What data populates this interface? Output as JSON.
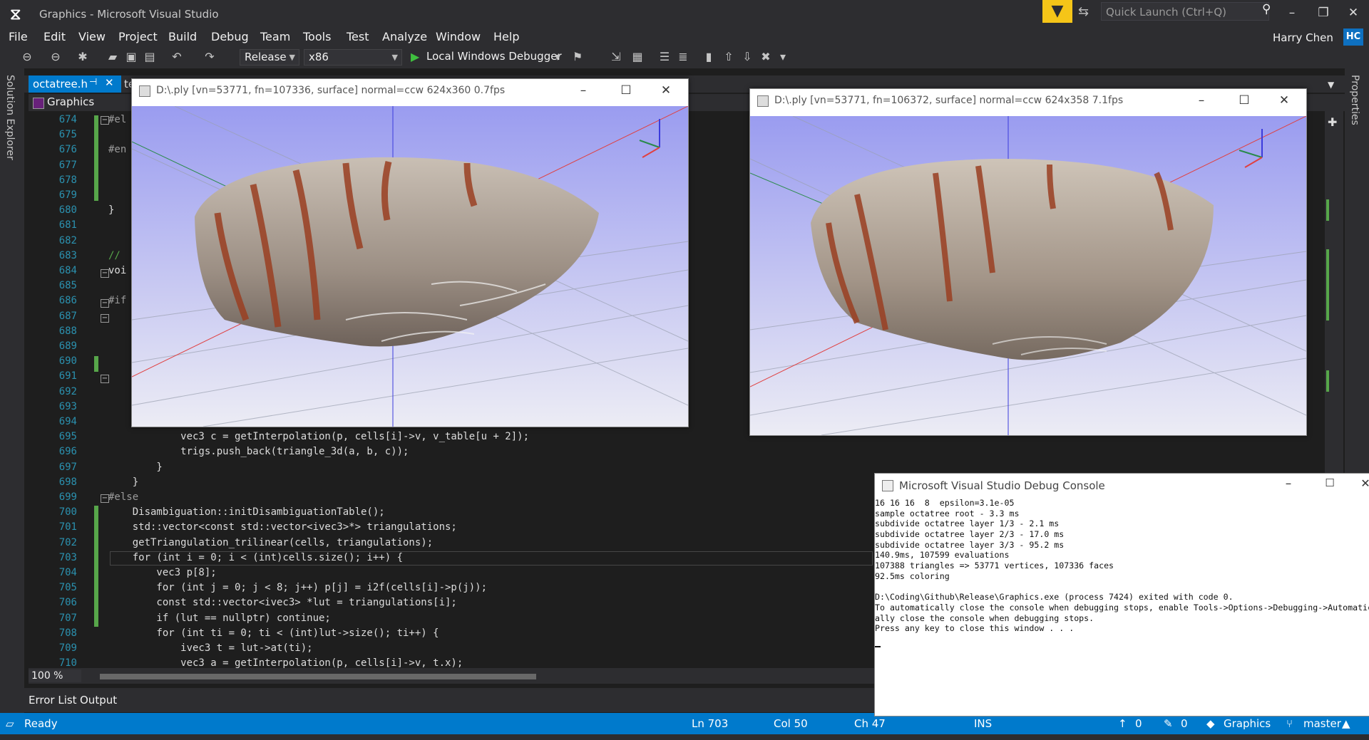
{
  "app": {
    "title": "Graphics - Microsoft Visual Studio",
    "quick_launch_placeholder": "Quick Launch (Ctrl+Q)",
    "user": "Harry Chen",
    "user_initials": "HC"
  },
  "menu": [
    "File",
    "Edit",
    "View",
    "Project",
    "Build",
    "Debug",
    "Team",
    "Tools",
    "Test",
    "Analyze",
    "Window",
    "Help"
  ],
  "toolbar": {
    "configuration": "Release",
    "platform": "x86",
    "debugger": "Local Windows Debugger"
  },
  "side": {
    "left_tab": "Solution Explorer",
    "right_tab": "Properties"
  },
  "tabs": {
    "active": "octatree.h",
    "second": "te"
  },
  "nav": {
    "project": "Graphics"
  },
  "editor": {
    "zoom": "100 %",
    "lines": [
      {
        "n": "674",
        "t": "#el"
      },
      {
        "n": "675",
        "t": ""
      },
      {
        "n": "676",
        "t": "#en"
      },
      {
        "n": "677",
        "t": ""
      },
      {
        "n": "678",
        "t": ""
      },
      {
        "n": "679",
        "t": ""
      },
      {
        "n": "680",
        "t": "}"
      },
      {
        "n": "681",
        "t": ""
      },
      {
        "n": "682",
        "t": ""
      },
      {
        "n": "683",
        "t": "//"
      },
      {
        "n": "684",
        "t": "voi"
      },
      {
        "n": "685",
        "t": ""
      },
      {
        "n": "686",
        "t": "#if"
      },
      {
        "n": "687",
        "t": ""
      },
      {
        "n": "688",
        "t": ""
      },
      {
        "n": "689",
        "t": ""
      },
      {
        "n": "690",
        "t": ""
      },
      {
        "n": "691",
        "t": ""
      },
      {
        "n": "692",
        "t": ""
      },
      {
        "n": "693",
        "t": ""
      },
      {
        "n": "694",
        "t": ""
      },
      {
        "n": "695",
        "t": "            vec3 c = getInterpolation(p, cells[i]->v, v_table[u + 2]);"
      },
      {
        "n": "696",
        "t": "            trigs.push_back(triangle_3d(a, b, c));"
      },
      {
        "n": "697",
        "t": "        }"
      },
      {
        "n": "698",
        "t": "    }"
      },
      {
        "n": "699",
        "t": "#else"
      },
      {
        "n": "700",
        "t": "    Disambiguation::initDisambiguationTable();"
      },
      {
        "n": "701",
        "t": "    std::vector<const std::vector<ivec3>*> triangulations;"
      },
      {
        "n": "702",
        "t": "    getTriangulation_trilinear(cells, triangulations);"
      },
      {
        "n": "703",
        "t": "    for (int i = 0; i < (int)cells.size(); i++) {"
      },
      {
        "n": "704",
        "t": "        vec3 p[8];"
      },
      {
        "n": "705",
        "t": "        for (int j = 0; j < 8; j++) p[j] = i2f(cells[i]->p(j));"
      },
      {
        "n": "706",
        "t": "        const std::vector<ivec3> *lut = triangulations[i];"
      },
      {
        "n": "707",
        "t": "        if (lut == nullptr) continue;"
      },
      {
        "n": "708",
        "t": "        for (int ti = 0; ti < (int)lut->size(); ti++) {"
      },
      {
        "n": "709",
        "t": "            ivec3 t = lut->at(ti);"
      },
      {
        "n": "710",
        "t": "            vec3 a = getInterpolation(p, cells[i]->v, t.x);"
      }
    ]
  },
  "viewers": [
    {
      "title": "D:\\.ply [vn=53771, fn=107336, surface]   normal=ccw   624x360 0.7fps"
    },
    {
      "title": "D:\\.ply [vn=53771, fn=106372, surface]   normal=ccw   624x358 7.1fps"
    }
  ],
  "console": {
    "title": "Microsoft Visual Studio Debug Console",
    "lines": [
      "16 16 16  8  epsilon=3.1e-05",
      "sample octatree root - 3.3 ms",
      "subdivide octatree layer 1/3 - 2.1 ms",
      "subdivide octatree layer 2/3 - 17.0 ms",
      "subdivide octatree layer 3/3 - 95.2 ms",
      "140.9ms, 107599 evaluations",
      "107388 triangles => 53771 vertices, 107336 faces",
      "92.5ms coloring",
      "",
      "D:\\Coding\\Github\\Release\\Graphics.exe (process 7424) exited with code 0.",
      "To automatically close the console when debugging stops, enable Tools->Options->Debugging->Automatic",
      "ally close the console when debugging stops.",
      "Press any key to close this window . . ."
    ]
  },
  "panel": {
    "error_list": "Error List",
    "output": "Output"
  },
  "status": {
    "state": "Ready",
    "ln": "Ln 703",
    "col": "Col 50",
    "ch": "Ch 47",
    "ins": "INS",
    "up_count": "0",
    "pencil_count": "0",
    "repo": "Graphics",
    "branch": "master"
  },
  "colors": {
    "accent": "#007acc",
    "background": "#1e1e1e",
    "chrome": "#2d2d30",
    "filter": "#f5c518"
  }
}
